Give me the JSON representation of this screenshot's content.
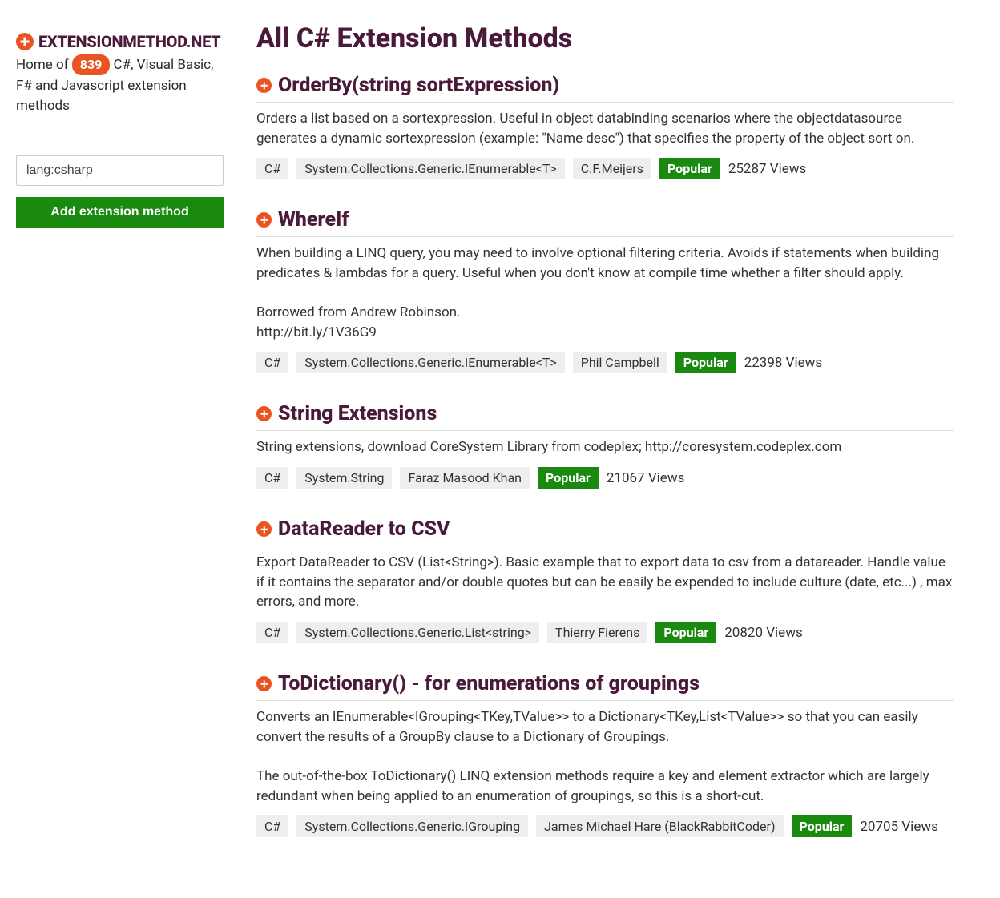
{
  "sidebar": {
    "site_name": "EXTENSIONMETHOD.NET",
    "intro_prefix": "Home of ",
    "count": "839",
    "links": [
      "C#",
      "Visual Basic",
      "F#"
    ],
    "intro_mid": " and ",
    "link_js": "Javascript",
    "intro_suffix": " extension methods",
    "search_value": "lang:csharp",
    "add_button": "Add extension method"
  },
  "page_title": "All C# Extension Methods",
  "popular_label": "Popular",
  "entries": [
    {
      "title": "OrderBy(string sortExpression)",
      "desc": "Orders a list based on a sortexpression. Useful in object databinding scenarios where the objectdatasource generates a dynamic sortexpression (example: \"Name desc\") that specifies the property of the object sort on.",
      "lang": "C#",
      "type": "System.Collections.Generic.IEnumerable<T>",
      "author": "C.F.Meijers",
      "popular": true,
      "views": "25287 Views"
    },
    {
      "title": "WhereIf",
      "desc": "When building a LINQ query, you may need to involve optional filtering criteria. Avoids if statements when building predicates & lambdas for a query. Useful when you don't know at compile time whether a filter should apply.\n\nBorrowed from Andrew Robinson.\nhttp://bit.ly/1V36G9",
      "lang": "C#",
      "type": "System.Collections.Generic.IEnumerable<T>",
      "author": "Phil Campbell",
      "popular": true,
      "views": "22398 Views"
    },
    {
      "title": "String Extensions",
      "desc": "String extensions, download CoreSystem Library from codeplex; http://coresystem.codeplex.com",
      "lang": "C#",
      "type": "System.String",
      "author": "Faraz Masood Khan",
      "popular": true,
      "views": "21067 Views"
    },
    {
      "title": "DataReader to CSV",
      "desc": "Export DataReader to CSV (List<String>). Basic example that to export data to csv from a datareader. Handle value if it contains the separator and/or double quotes but can be easily be expended to include culture (date, etc...) , max errors, and more.",
      "lang": "C#",
      "type": "System.Collections.Generic.List<string>",
      "author": "Thierry Fierens",
      "popular": true,
      "views": "20820 Views"
    },
    {
      "title": "ToDictionary() - for enumerations of groupings",
      "desc": "Converts an IEnumerable<IGrouping<TKey,TValue>> to a Dictionary<TKey,List<TValue>> so that you can easily convert the results of a GroupBy clause to a Dictionary of Groupings.\n\nThe out-of-the-box ToDictionary() LINQ extension methods require a key and element extractor which are largely redundant when being applied to an enumeration of groupings, so this is a short-cut.",
      "lang": "C#",
      "type": "System.Collections.Generic.IGrouping",
      "author": "James Michael Hare (BlackRabbitCoder)",
      "popular": true,
      "views": "20705 Views"
    }
  ]
}
